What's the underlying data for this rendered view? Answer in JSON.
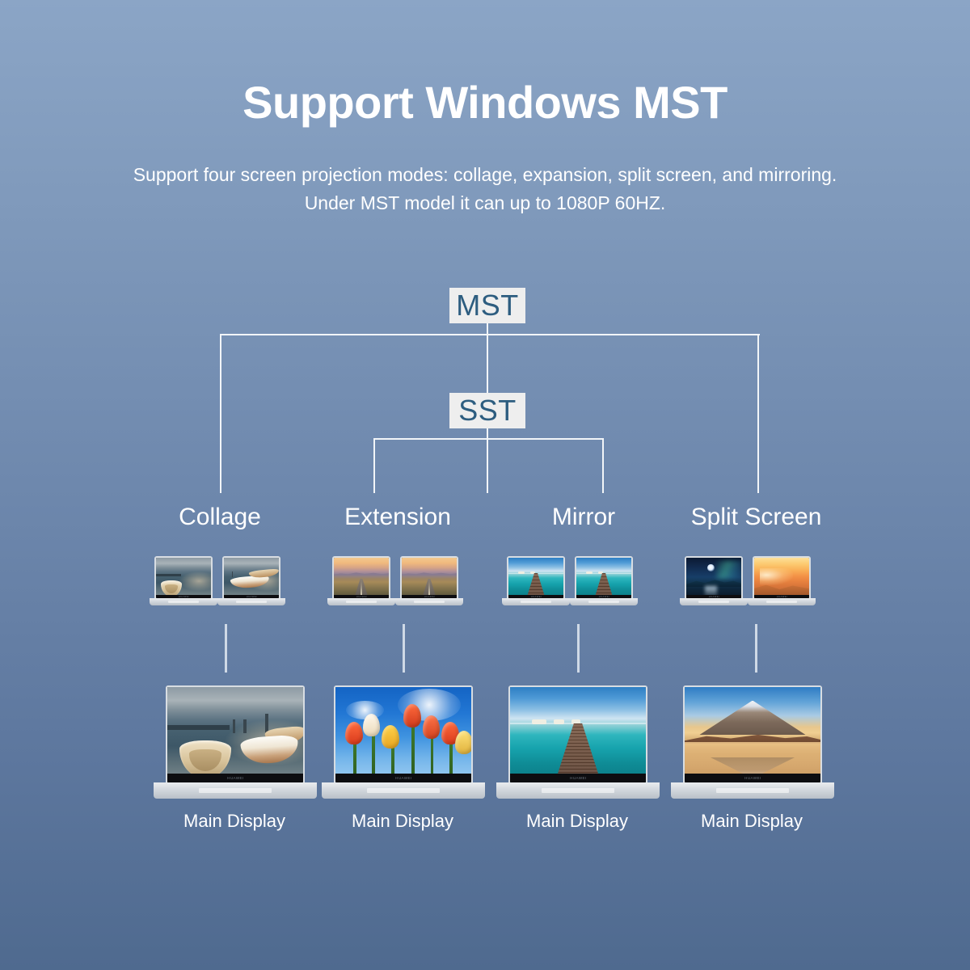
{
  "header": {
    "title": "Support Windows MST",
    "subtitle_line1": "Support four screen projection modes: collage, expansion, split screen, and mirroring.",
    "subtitle_line2": "Under MST model it can up to 1080P 60HZ."
  },
  "colors": {
    "background_top": "#8ba5c6",
    "background_bottom": "#4f6a8f",
    "node_background": "#eeeeee",
    "node_text": "#2d5d80",
    "line": "#f2f5f8",
    "text": "#ffffff"
  },
  "diagram": {
    "root_node": "MST",
    "child_node": "SST",
    "branches": [
      {
        "label": "Collage",
        "main_display_label": "Main Display",
        "parent": "MST",
        "secondary_screens": [
          "harbor-left-half",
          "harbor-right-half"
        ],
        "main_screen": "harbor-boats-full"
      },
      {
        "label": "Extension",
        "main_display_label": "Main Display",
        "parent": "SST",
        "secondary_screens": [
          "desert-road-sunset",
          "desert-road-sunset"
        ],
        "main_screen": "red-tulips-blue-sky"
      },
      {
        "label": "Mirror",
        "main_display_label": "Main Display",
        "parent": "SST",
        "secondary_screens": [
          "wooden-pier-ocean",
          "wooden-pier-ocean"
        ],
        "main_screen": "wooden-pier-ocean"
      },
      {
        "label": "Split Screen",
        "main_display_label": "Main Display",
        "parent": "MST",
        "secondary_screens": [
          "night-aurora-moon",
          "orange-sunset-dunes"
        ],
        "main_screen": "mount-fuji-reflection"
      }
    ]
  }
}
